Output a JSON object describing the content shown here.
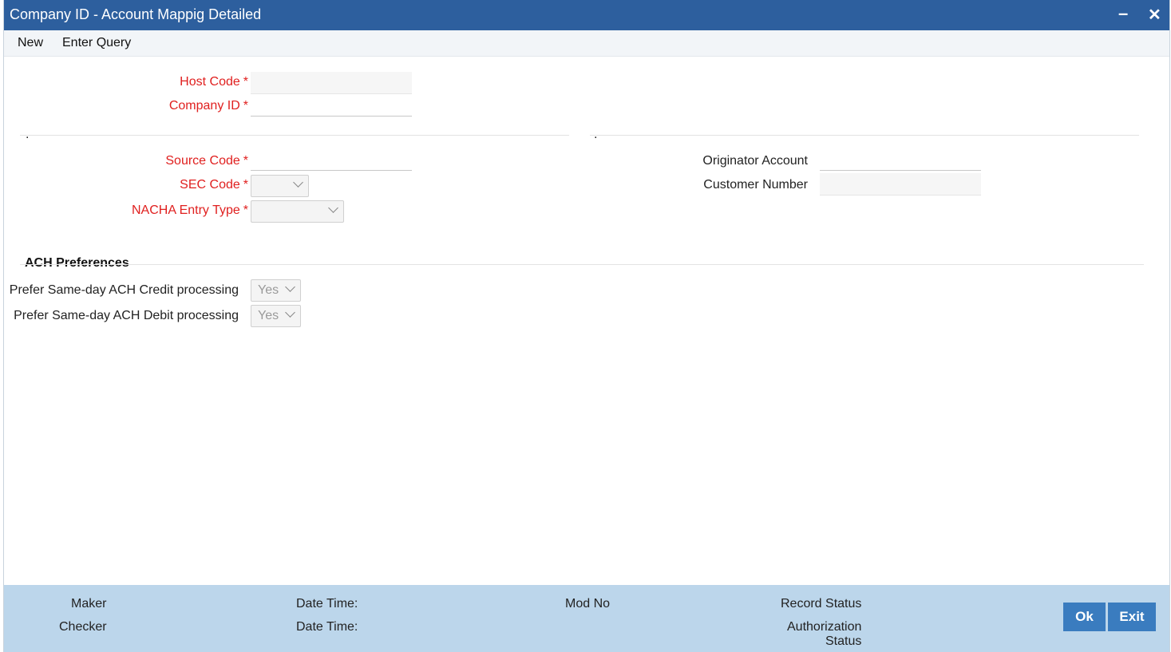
{
  "window": {
    "title": "Company ID - Account Mappig Detailed",
    "minimize_icon": "minimize-icon",
    "close_icon": "close-icon"
  },
  "menu": {
    "new": "New",
    "enter_query": "Enter Query"
  },
  "form": {
    "host_code": {
      "label": "Host Code",
      "required": "*",
      "value": ""
    },
    "company_id": {
      "label": "Company ID",
      "required": "*",
      "value": ""
    },
    "left_section_marker": ".",
    "right_section_marker": ".",
    "source_code": {
      "label": "Source Code",
      "required": "*",
      "value": ""
    },
    "sec_code": {
      "label": "SEC Code",
      "required": "*",
      "value": ""
    },
    "nacha_entry_type": {
      "label": "NACHA Entry Type",
      "required": "*",
      "value": ""
    },
    "originator_account": {
      "label": "Originator Account",
      "value": ""
    },
    "customer_number": {
      "label": "Customer Number",
      "value": ""
    }
  },
  "ach": {
    "title": "ACH Preferences",
    "credit": {
      "label": "Prefer Same-day ACH Credit processing",
      "value": "Yes"
    },
    "debit": {
      "label": "Prefer Same-day ACH Debit processing",
      "value": "Yes"
    }
  },
  "footer": {
    "maker": "Maker",
    "checker": "Checker",
    "date_time_1": "Date Time:",
    "date_time_2": "Date Time:",
    "mod_no": "Mod No",
    "record_status": "Record Status",
    "authorization_status_1": "Authorization",
    "authorization_status_2": "Status",
    "ok": "Ok",
    "exit": "Exit"
  },
  "colors": {
    "title_bar": "#2d5f9e",
    "required_label": "#e0201f",
    "footer_bg": "#bcd6eb",
    "button_bg": "#3a7cbf"
  }
}
